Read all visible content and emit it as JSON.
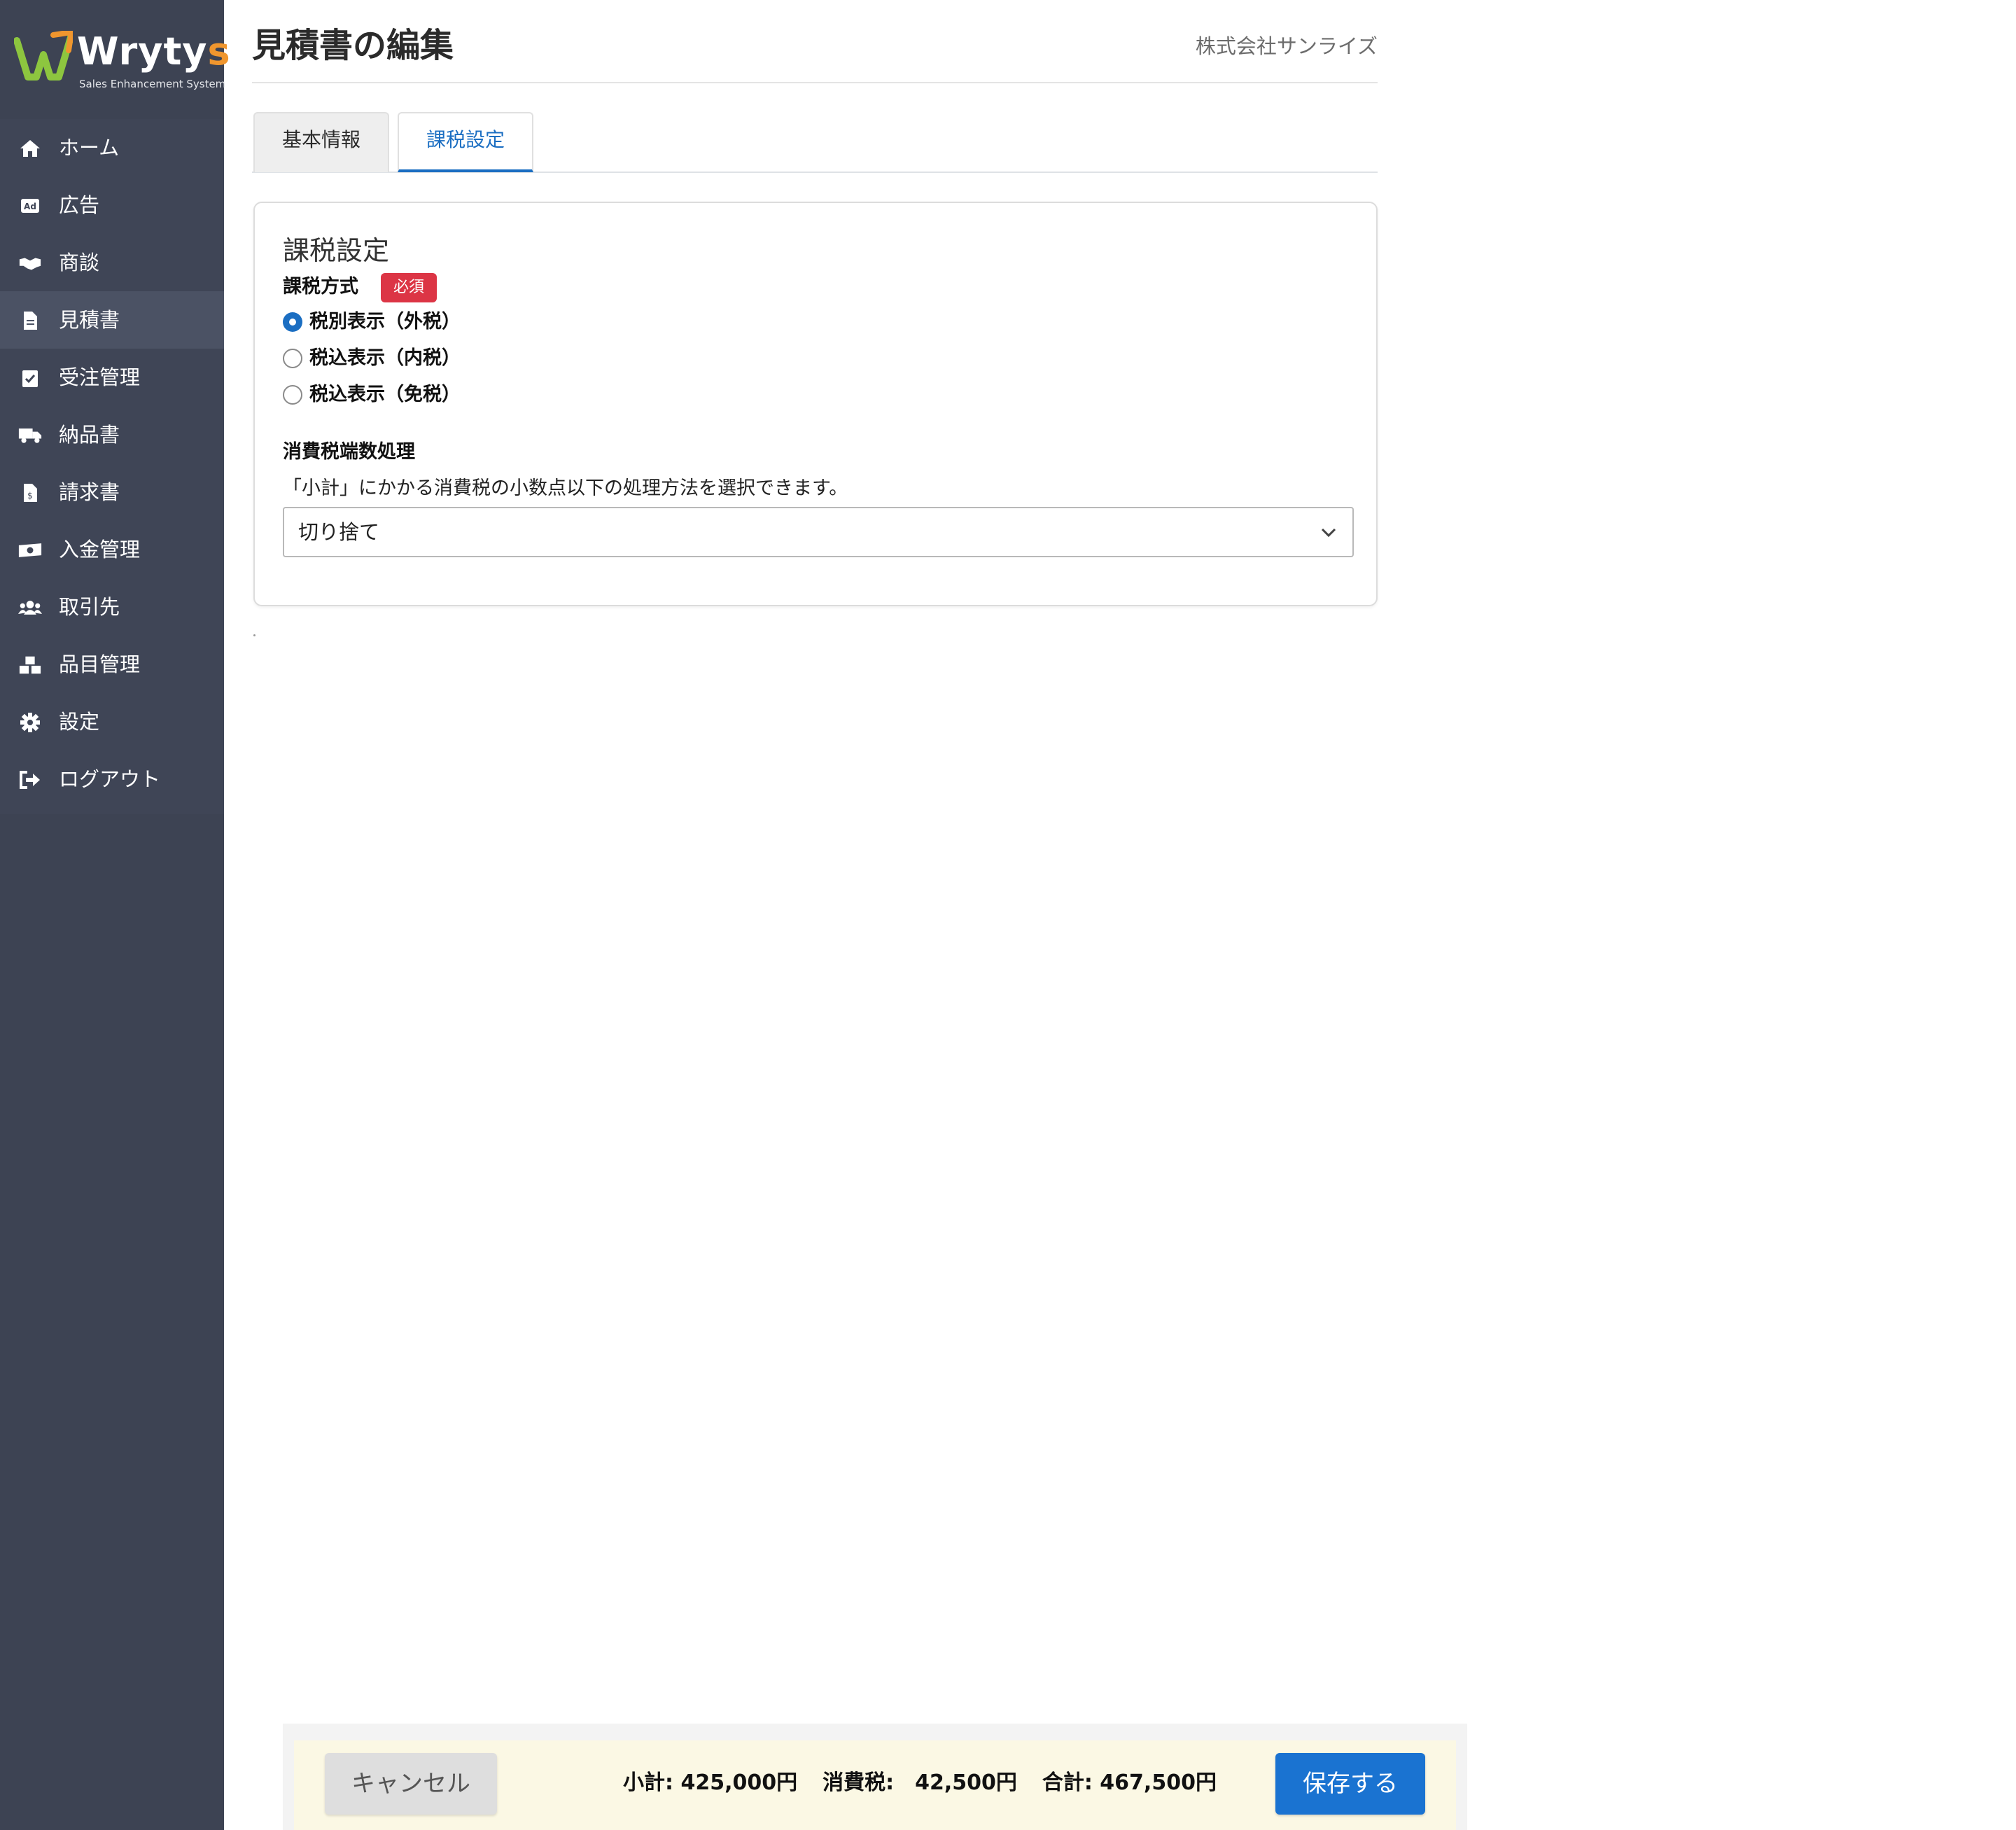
{
  "app": {
    "logo_text_main": "Wryty",
    "logo_text_s": "s",
    "logo_tagline": "Sales Enhancement System",
    "brand_accent": "#f0962e",
    "sidebar_bg": "#3d4353"
  },
  "sidebar": {
    "items": [
      {
        "label": "ホーム",
        "icon": "home-icon",
        "active": false
      },
      {
        "label": "広告",
        "icon": "ad-icon",
        "active": false
      },
      {
        "label": "商談",
        "icon": "handshake-icon",
        "active": false
      },
      {
        "label": "見積書",
        "icon": "document-icon",
        "active": true
      },
      {
        "label": "受注管理",
        "icon": "clipboard-check-icon",
        "active": false
      },
      {
        "label": "納品書",
        "icon": "truck-icon",
        "active": false
      },
      {
        "label": "請求書",
        "icon": "invoice-icon",
        "active": false
      },
      {
        "label": "入金管理",
        "icon": "money-icon",
        "active": false
      },
      {
        "label": "取引先",
        "icon": "users-icon",
        "active": false
      },
      {
        "label": "品目管理",
        "icon": "boxes-icon",
        "active": false
      },
      {
        "label": "設定",
        "icon": "gear-icon",
        "active": false
      },
      {
        "label": "ログアウト",
        "icon": "logout-icon",
        "active": false
      }
    ]
  },
  "header": {
    "title": "見積書の編集",
    "company": "株式会社サンライズ"
  },
  "tabs": [
    {
      "label": "基本情報",
      "active": false
    },
    {
      "label": "課税設定",
      "active": true
    }
  ],
  "tax_settings": {
    "card_title": "課税設定",
    "method_label": "課税方式",
    "required_badge": "必須",
    "options": [
      {
        "label": "税別表示（外税）",
        "checked": true
      },
      {
        "label": "税込表示（内税）",
        "checked": false
      },
      {
        "label": "税込表示（免税）",
        "checked": false
      }
    ],
    "rounding_label": "消費税端数処理",
    "rounding_help": "「小計」にかかる消費税の小数点以下の処理方法を選択できます。",
    "rounding_value": "切り捨て"
  },
  "footer": {
    "cancel_label": "キャンセル",
    "subtotal": "小計: 425,000円",
    "tax": "消費税:　42,500円",
    "total": "合計: 467,500円",
    "save_label": "保存する",
    "save_color": "#1a73d1",
    "bar_color": "#fbf8e4"
  }
}
